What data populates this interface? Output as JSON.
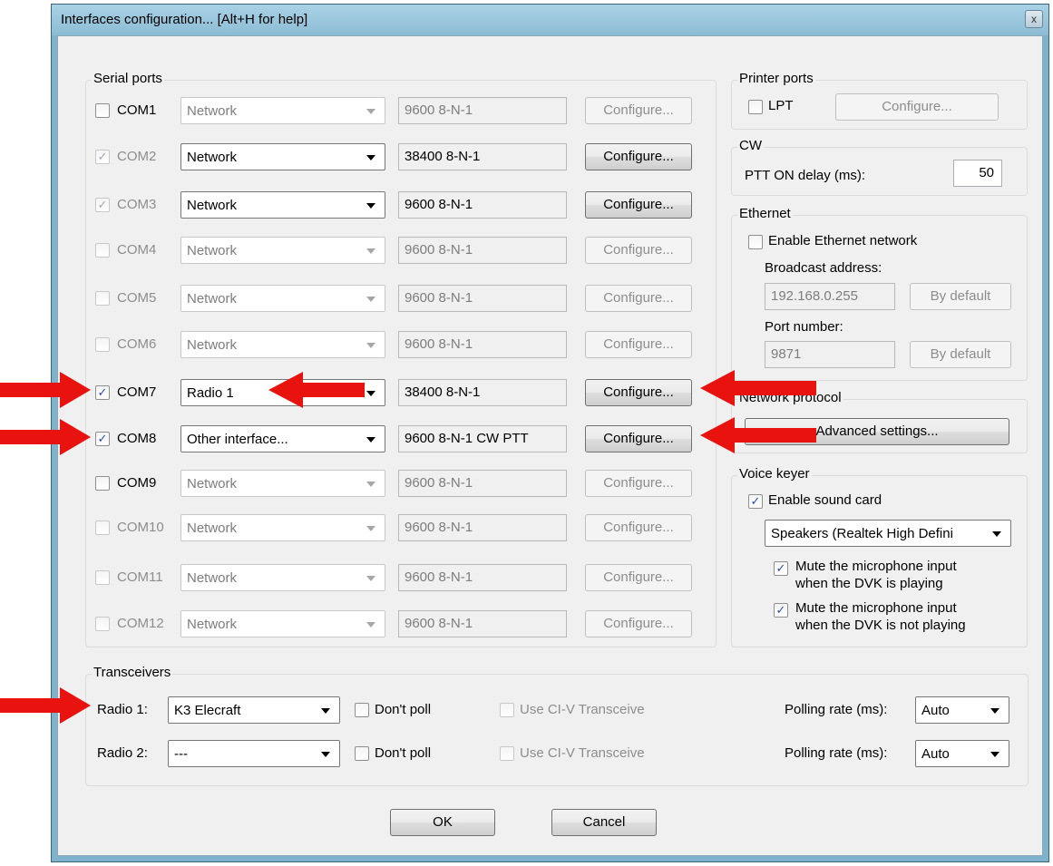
{
  "window": {
    "title": "Interfaces configuration... [Alt+H for help]",
    "close_glyph": "x"
  },
  "serial_ports": {
    "legend": "Serial ports",
    "rows": [
      {
        "name": "COM1",
        "checked": false,
        "enabled": true,
        "type": "Network",
        "type_enabled": false,
        "params": "9600 8-N-1",
        "configure": "Configure...",
        "configure_enabled": false
      },
      {
        "name": "COM2",
        "checked": true,
        "enabled": false,
        "type": "Network",
        "type_enabled": true,
        "params": "38400 8-N-1",
        "configure": "Configure...",
        "configure_enabled": true
      },
      {
        "name": "COM3",
        "checked": true,
        "enabled": false,
        "type": "Network",
        "type_enabled": true,
        "params": "9600 8-N-1",
        "configure": "Configure...",
        "configure_enabled": true
      },
      {
        "name": "COM4",
        "checked": false,
        "enabled": false,
        "type": "Network",
        "type_enabled": false,
        "params": "9600 8-N-1",
        "configure": "Configure...",
        "configure_enabled": false
      },
      {
        "name": "COM5",
        "checked": false,
        "enabled": false,
        "type": "Network",
        "type_enabled": false,
        "params": "9600 8-N-1",
        "configure": "Configure...",
        "configure_enabled": false
      },
      {
        "name": "COM6",
        "checked": false,
        "enabled": false,
        "type": "Network",
        "type_enabled": false,
        "params": "9600 8-N-1",
        "configure": "Configure...",
        "configure_enabled": false
      },
      {
        "name": "COM7",
        "checked": true,
        "enabled": true,
        "type": "Radio 1",
        "type_enabled": true,
        "params": "38400 8-N-1",
        "configure": "Configure...",
        "configure_enabled": true
      },
      {
        "name": "COM8",
        "checked": true,
        "enabled": true,
        "type": "Other interface...",
        "type_enabled": true,
        "params": "9600 8-N-1 CW PTT",
        "configure": "Configure...",
        "configure_enabled": true
      },
      {
        "name": "COM9",
        "checked": false,
        "enabled": true,
        "type": "Network",
        "type_enabled": false,
        "params": "9600 8-N-1",
        "configure": "Configure...",
        "configure_enabled": false
      },
      {
        "name": "COM10",
        "checked": false,
        "enabled": false,
        "type": "Network",
        "type_enabled": false,
        "params": "9600 8-N-1",
        "configure": "Configure...",
        "configure_enabled": false
      },
      {
        "name": "COM11",
        "checked": false,
        "enabled": false,
        "type": "Network",
        "type_enabled": false,
        "params": "9600 8-N-1",
        "configure": "Configure...",
        "configure_enabled": false
      },
      {
        "name": "COM12",
        "checked": false,
        "enabled": false,
        "type": "Network",
        "type_enabled": false,
        "params": "9600 8-N-1",
        "configure": "Configure...",
        "configure_enabled": false
      }
    ]
  },
  "printer_ports": {
    "legend": "Printer ports",
    "lpt_label": "LPT",
    "lpt_checked": false,
    "configure": "Configure..."
  },
  "cw": {
    "legend": "CW",
    "ptt_label": "PTT ON delay (ms):",
    "ptt_value": "50"
  },
  "ethernet": {
    "legend": "Ethernet",
    "enable_label": "Enable Ethernet network",
    "enable_checked": false,
    "broadcast_label": "Broadcast address:",
    "broadcast_value": "192.168.0.255",
    "broadcast_default": "By default",
    "port_label": "Port number:",
    "port_value": "9871",
    "port_default": "By default"
  },
  "network_protocol": {
    "legend": "Network protocol",
    "advanced": "Advanced settings..."
  },
  "voice_keyer": {
    "legend": "Voice keyer",
    "enable_label": "Enable sound card",
    "enable_checked": true,
    "device": "Speakers (Realtek High Defini",
    "mute_playing_1": "Mute the microphone input",
    "mute_playing_2": "when the DVK is playing",
    "mute_not_playing_1": "Mute the microphone input",
    "mute_not_playing_2": "when the DVK is not playing"
  },
  "transceivers": {
    "legend": "Transceivers",
    "radio1_label": "Radio 1:",
    "radio1_value": "K3 Elecraft",
    "radio2_label": "Radio 2:",
    "radio2_value": "---",
    "dont_poll": "Don't poll",
    "use_civ": "Use CI-V Transceive",
    "polling_label": "Polling rate (ms):",
    "polling_value": "Auto"
  },
  "buttons": {
    "ok": "OK",
    "cancel": "Cancel"
  },
  "check_glyph": "✓",
  "colors": {
    "annotation_arrow": "#e8130f",
    "window_frame": "#7fb3cc"
  }
}
